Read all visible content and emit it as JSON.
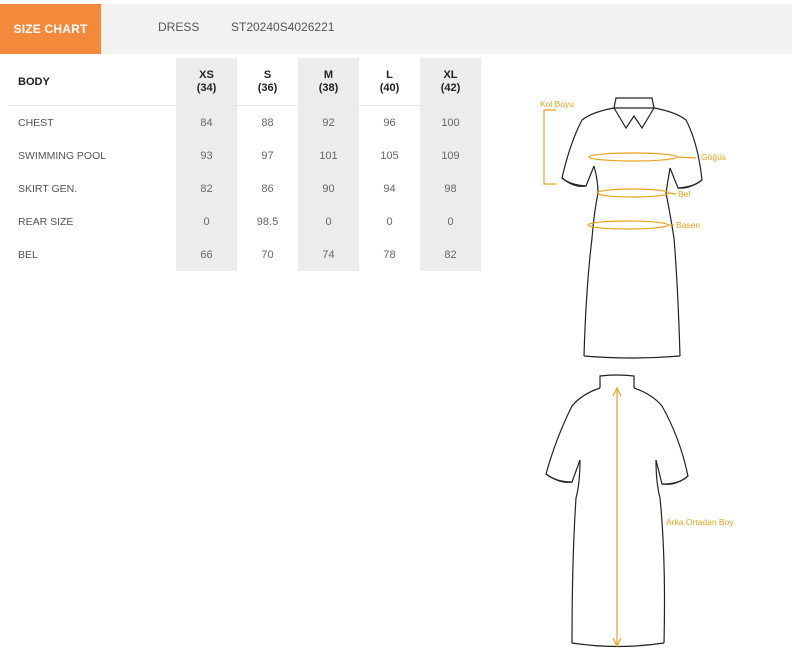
{
  "header": {
    "tab_label": "SIZE CHART",
    "product_type": "DRESS",
    "product_code": "ST20240S4026221"
  },
  "table": {
    "corner_label": "BODY",
    "columns": [
      {
        "size": "XS",
        "eu": "(34)"
      },
      {
        "size": "S",
        "eu": "(36)"
      },
      {
        "size": "M",
        "eu": "(38)"
      },
      {
        "size": "L",
        "eu": "(40)"
      },
      {
        "size": "XL",
        "eu": "(42)"
      }
    ],
    "rows": [
      {
        "label": "CHEST",
        "values": [
          "84",
          "88",
          "92",
          "96",
          "100"
        ]
      },
      {
        "label": "SWIMMING POOL",
        "values": [
          "93",
          "97",
          "101",
          "105",
          "109"
        ]
      },
      {
        "label": "SKIRT GEN.",
        "values": [
          "82",
          "86",
          "90",
          "94",
          "98"
        ]
      },
      {
        "label": "REAR SIZE",
        "values": [
          "0",
          "98.5",
          "0",
          "0",
          "0"
        ]
      },
      {
        "label": "BEL",
        "values": [
          "66",
          "70",
          "74",
          "78",
          "82"
        ]
      }
    ]
  },
  "diagram": {
    "front_labels": {
      "sleeve": "Kol Boyu",
      "chest": "Göğüs",
      "waist": "Bel",
      "hip": "Basen"
    },
    "back_labels": {
      "length": "Arka Ortadan Boy"
    },
    "accent_color": "#e8a21a"
  }
}
